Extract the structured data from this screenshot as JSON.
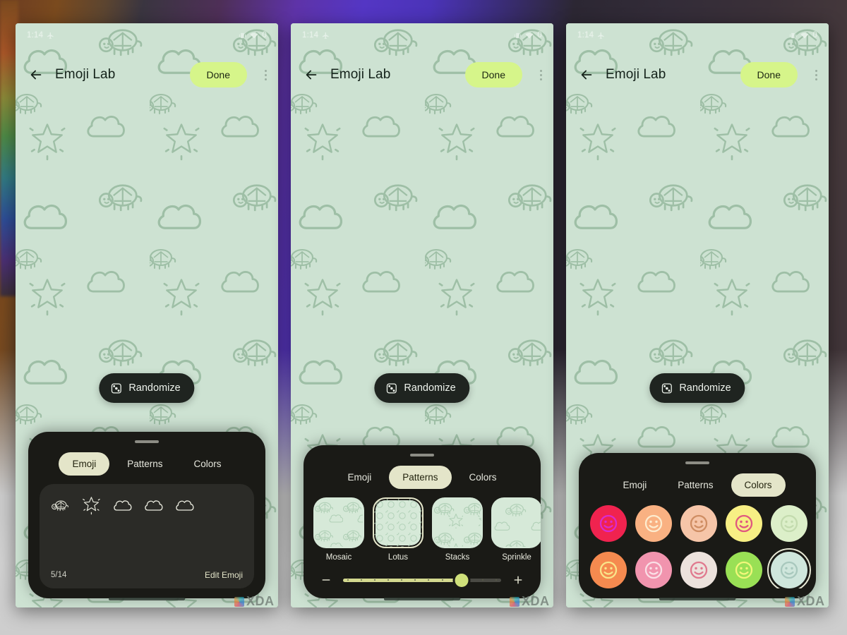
{
  "statusbar": {
    "time": "1:14",
    "left_icons": [
      "airplane-icon"
    ],
    "right_icons": [
      "vibrate-icon",
      "wifi-icon",
      "battery-icon"
    ],
    "battery_label": "0"
  },
  "appbar": {
    "back_icon": "back-arrow-icon",
    "title": "Emoji Lab",
    "done_label": "Done",
    "overflow_icon": "more-vert-icon"
  },
  "canvas": {
    "randomize_label": "Randomize",
    "randomize_icon": "shuffle-dice-icon",
    "wallpaper_color": "#cde2d2",
    "wallpaper_line_color": "#9dbda4",
    "wallpaper_motifs": [
      "cloud",
      "turtle",
      "sparkle-star"
    ]
  },
  "tabs": {
    "emoji": "Emoji",
    "patterns": "Patterns",
    "colors": "Colors"
  },
  "panel_emoji": {
    "active_tab": "Emoji",
    "emoji_slots": [
      "turtle",
      "sparkle-star",
      "cloud",
      "cloud",
      "cloud"
    ],
    "count_label": "5/14",
    "edit_label": "Edit Emoji"
  },
  "panel_patterns": {
    "active_tab": "Patterns",
    "items": [
      {
        "name": "Mosaic",
        "selected": false
      },
      {
        "name": "Lotus",
        "selected": true
      },
      {
        "name": "Stacks",
        "selected": false
      },
      {
        "name": "Sprinkle",
        "selected": false
      },
      {
        "name": "",
        "selected": false
      }
    ],
    "slider": {
      "minus_icon": "minus-icon",
      "plus_icon": "plus-icon",
      "value_percent": 75,
      "fill_color": "#d4d98f",
      "thumb_color": "#cfe07a"
    }
  },
  "panel_colors": {
    "active_tab": "Colors",
    "swatches": [
      {
        "bg": "#f0234f",
        "face": "#d92bd0",
        "selected": false
      },
      {
        "bg": "#f9b182",
        "face": "#fdeccf",
        "selected": false
      },
      {
        "bg": "#f6c5a8",
        "face": "#cf8d63",
        "selected": false
      },
      {
        "bg": "#f7ef84",
        "face": "#e0577f",
        "selected": false
      },
      {
        "bg": "#dcefc9",
        "face": "#c3dbae",
        "selected": false
      },
      {
        "bg": "#f58a4f",
        "face": "#f9e58a",
        "selected": false
      },
      {
        "bg": "#f194ae",
        "face": "#fadfe6",
        "selected": false
      },
      {
        "bg": "#ece2dc",
        "face": "#e0798e",
        "selected": false
      },
      {
        "bg": "#99e055",
        "face": "#f2f77a",
        "selected": false
      },
      {
        "bg": "#cfe6dc",
        "face": "#a8c8bd",
        "selected": true
      }
    ]
  },
  "watermark": {
    "text": "XDA"
  },
  "theme": {
    "sheet_bg": "#1a1a16",
    "tab_active_bg": "#e4e5c9",
    "done_bg": "#d6f58a",
    "randomize_bg": "#1f2420"
  }
}
